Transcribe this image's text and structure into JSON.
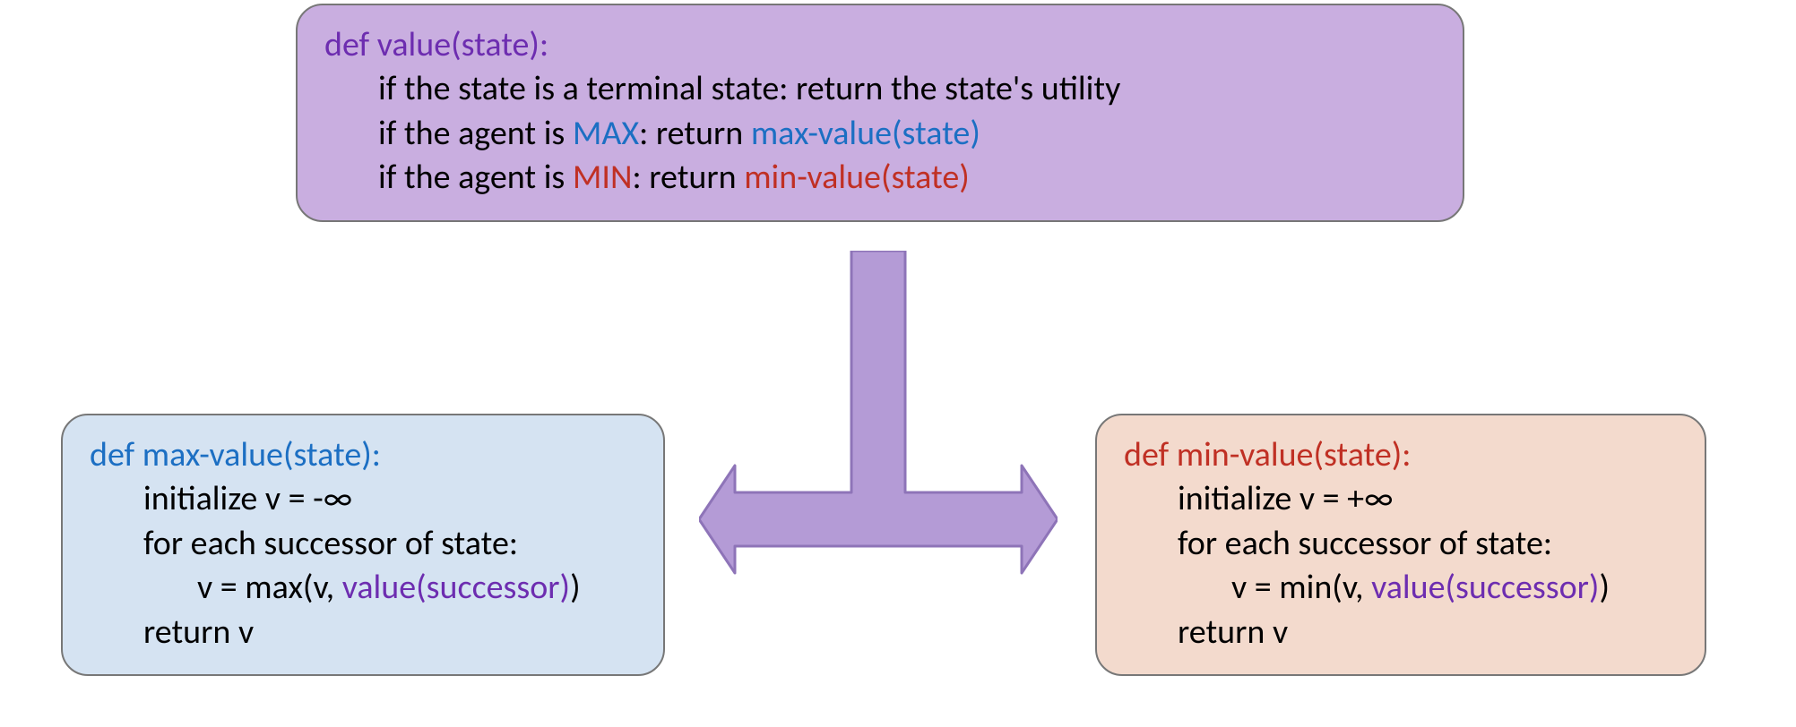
{
  "top": {
    "def": "def value(state):",
    "l1": "if the state is a terminal state: return the state's utility",
    "l2a": "if the agent is ",
    "l2b": "MAX",
    "l2c": ": return ",
    "l2d": "max-value(state)",
    "l3a": "if the agent is ",
    "l3b": "MIN",
    "l3c": ": return ",
    "l3d": "min-value(state)"
  },
  "left": {
    "def": "def max-value(state):",
    "l1": "initialize v = -∞",
    "l2": "for each successor of state:",
    "l3a": "v = max(v, ",
    "l3b": "value(successor)",
    "l3c": ")",
    "l4": "return v"
  },
  "right": {
    "def": "def min-value(state):",
    "l1": "initialize v = +∞",
    "l2": "for each successor of state:",
    "l3a": "v = min(v, ",
    "l3b": "value(successor)",
    "l3c": ")",
    "l4": "return v"
  }
}
